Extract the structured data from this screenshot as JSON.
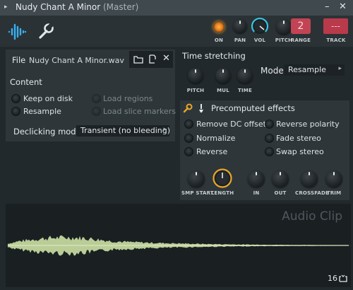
{
  "window": {
    "title": "Nudy Chant A Minor",
    "subtitle": "(Master)",
    "menu_glyph": "▸",
    "minimize_glyph": "–",
    "close_glyph": "✕"
  },
  "toolbar": {
    "tabs": [
      {
        "name": "waveform-tab",
        "icon": "waveform-icon",
        "active": true
      },
      {
        "name": "settings-tab",
        "icon": "wrench-icon",
        "active": false
      }
    ],
    "knobs": [
      {
        "label": "ON"
      },
      {
        "label": "PAN"
      },
      {
        "label": "VOL"
      },
      {
        "label": "PITCH"
      }
    ],
    "range_label": "RANGE",
    "range_value": "2",
    "track_label": "TRACK",
    "track_value": "---"
  },
  "file": {
    "label": "File",
    "name": "Nudy Chant A Minor.wav"
  },
  "content": {
    "title": "Content",
    "options": [
      {
        "label": "Keep on disk",
        "enabled": true
      },
      {
        "label": "Resample",
        "enabled": true
      },
      {
        "label": "Load regions",
        "enabled": false
      },
      {
        "label": "Load slice markers",
        "enabled": false
      }
    ],
    "declicking_label": "Declicking mode",
    "declicking_value": "Transient (no bleeding)"
  },
  "time_stretching": {
    "title": "Time stretching",
    "knobs": [
      "PITCH",
      "MUL",
      "TIME"
    ],
    "mode_label": "Mode",
    "mode_value": "Resample"
  },
  "precomputed": {
    "title": "Precomputed effects",
    "options_left": [
      "Remove DC offset",
      "Normalize",
      "Reverse"
    ],
    "options_right": [
      "Reverse polarity",
      "Fade stereo",
      "Swap stereo"
    ],
    "knobs": [
      "SMP START",
      "LENGTH",
      "IN",
      "OUT",
      "CROSSFADE",
      "TRIM"
    ]
  },
  "waveform": {
    "watermark": "Audio Clip",
    "grid_value": "16",
    "colors": {
      "wave": "#c8dca2",
      "accent_yellow": "#e8a62a",
      "vol_ring": "#35c7e0",
      "range": "#e14a5a",
      "track": "#c73b4c"
    }
  }
}
